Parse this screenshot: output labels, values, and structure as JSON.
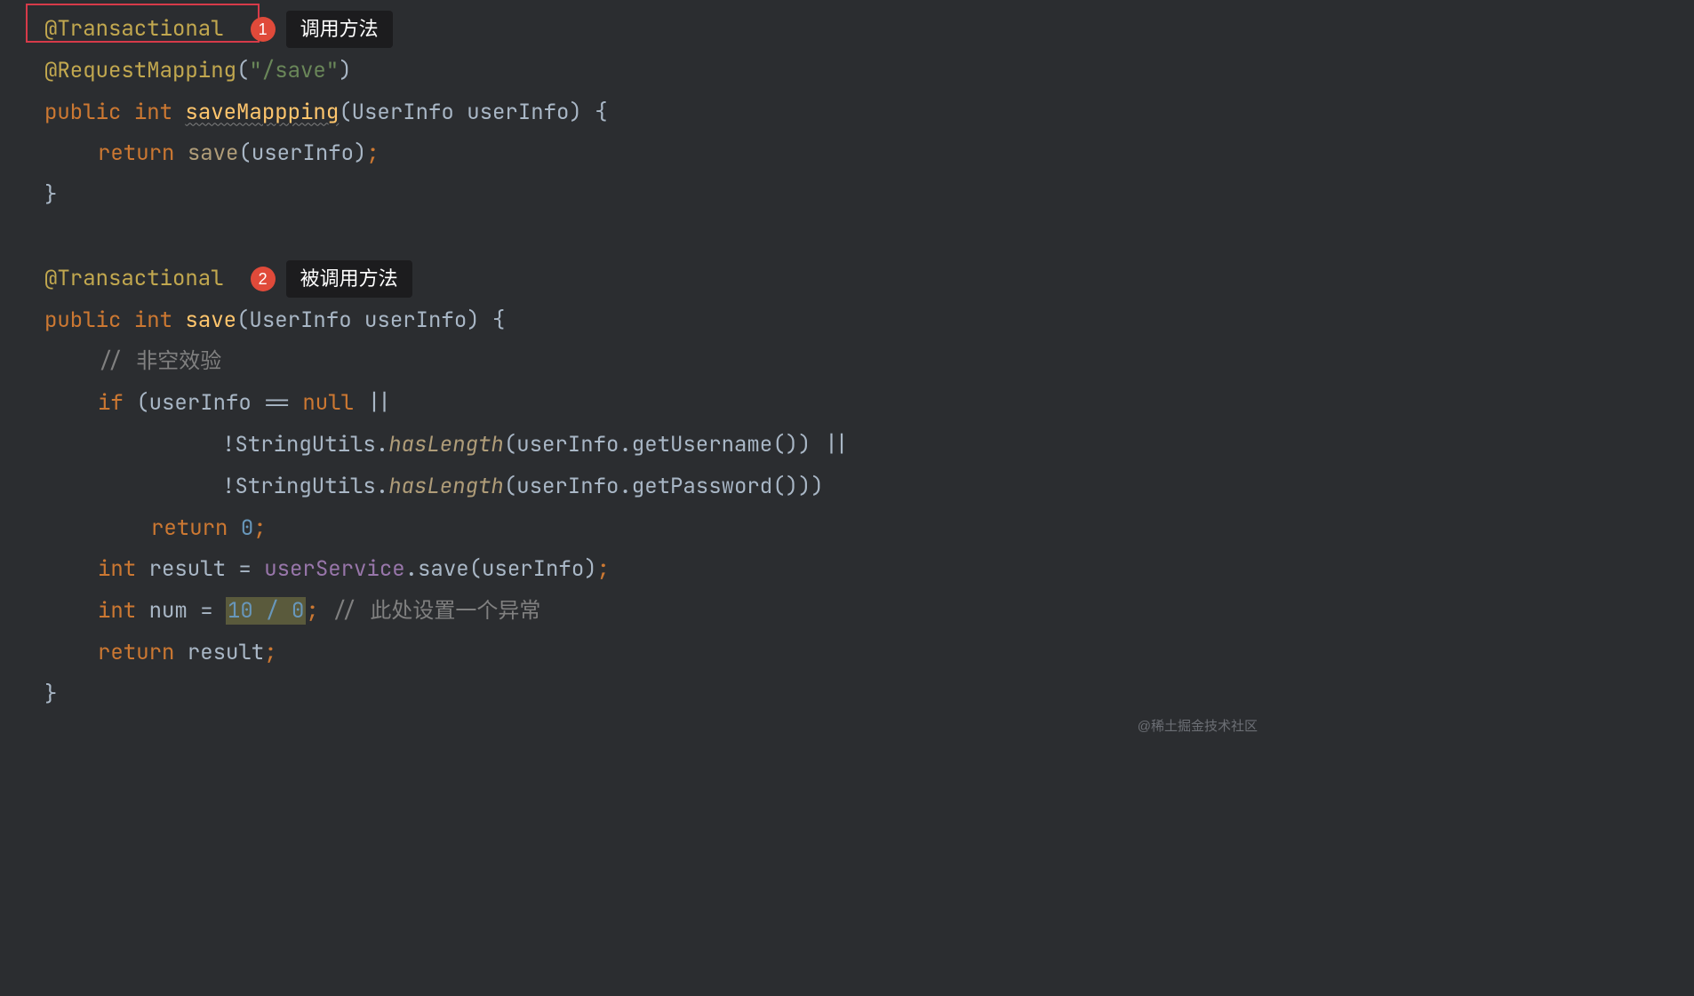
{
  "badge1": {
    "num": "1",
    "label": "调用方法"
  },
  "badge2": {
    "num": "2",
    "label": "被调用方法"
  },
  "line1": {
    "ann": "@Transactional"
  },
  "line2": {
    "ann": "@RequestMapping",
    "p1": "(",
    "str": "\"/save\"",
    "p2": ")"
  },
  "line3": {
    "kw1": "public ",
    "kw2": "int ",
    "m": "saveMappping",
    "sig": "(UserInfo userInfo) {"
  },
  "line4": {
    "kw": "return ",
    "call": "save",
    "arg": "(userInfo)",
    "semi": ";"
  },
  "line5": {
    "brace": "}"
  },
  "line6": {
    "ann": "@Transactional"
  },
  "line7": {
    "kw1": "public ",
    "kw2": "int ",
    "m": "save",
    "sig": "(UserInfo userInfo) {"
  },
  "line8": {
    "c": "// 非空效验"
  },
  "line9": {
    "kw1": "if ",
    "p1": "(userInfo == ",
    "kw2": "null ",
    "op": "||"
  },
  "line10": {
    "neg": "!StringUtils.",
    "m": "hasLength",
    "p1": "(userInfo.getUsername()) ||"
  },
  "line11": {
    "neg": "!StringUtils.",
    "m": "hasLength",
    "p1": "(userInfo.getPassword()))"
  },
  "line12": {
    "kw": "return ",
    "n": "0",
    "semi": ";"
  },
  "line13": {
    "kw": "int ",
    "v": "result = ",
    "f": "userService",
    "dot": ".save(userInfo)",
    "semi": ";"
  },
  "line14": {
    "kw": "int ",
    "v": "num = ",
    "hl": "10 / 0",
    "semi": "; ",
    "c": "// 此处设置一个异常"
  },
  "line15": {
    "kw": "return ",
    "v": "result",
    "semi": ";"
  },
  "line16": {
    "brace": "}"
  },
  "watermark": "@稀土掘金技术社区"
}
